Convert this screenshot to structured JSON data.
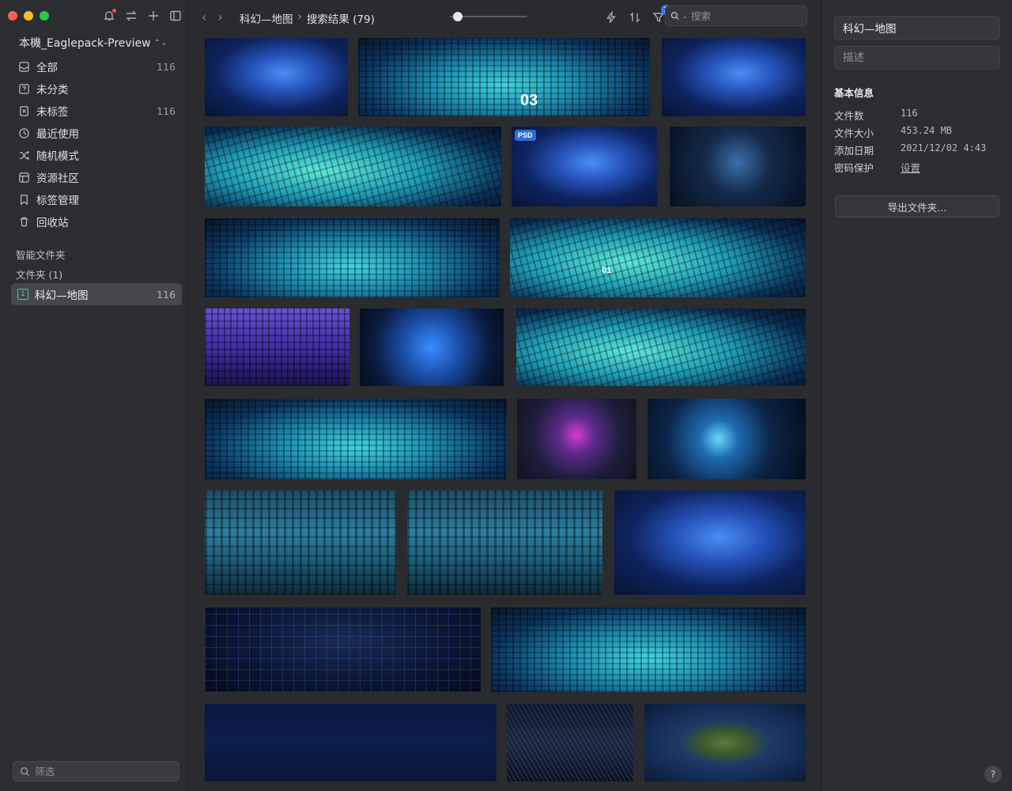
{
  "sidebar": {
    "library_name": "本機_Eaglepack-Preview",
    "items": [
      {
        "label": "全部",
        "count": "116",
        "icon": "inbox-icon"
      },
      {
        "label": "未分类",
        "count": "",
        "icon": "question-box-icon"
      },
      {
        "label": "未标签",
        "count": "116",
        "icon": "untagged-icon"
      },
      {
        "label": "最近使用",
        "count": "",
        "icon": "clock-icon"
      },
      {
        "label": "随机模式",
        "count": "",
        "icon": "shuffle-icon"
      },
      {
        "label": "资源社区",
        "count": "",
        "icon": "community-icon"
      },
      {
        "label": "标签管理",
        "count": "",
        "icon": "bookmark-icon"
      },
      {
        "label": "回收站",
        "count": "",
        "icon": "trash-icon"
      }
    ],
    "smart_folders_label": "智能文件夹",
    "folders_label": "文件夹 (1)",
    "folder": {
      "label": "科幻—地图",
      "count": "116",
      "badge": "1"
    },
    "filter_placeholder": "筛选"
  },
  "toolbar": {
    "back": "‹",
    "forward": "›",
    "breadcrumb_folder": "科幻—地图",
    "breadcrumb_sep": "›",
    "breadcrumb_current": "搜索结果 (79)",
    "zoom_level": 0.05,
    "filter_badge": "1",
    "search_placeholder": "搜索"
  },
  "thumbnails": [
    {
      "style": "map-cn",
      "label": ""
    },
    {
      "style": "city",
      "label": "03"
    },
    {
      "style": "map-cn",
      "label": ""
    },
    {
      "style": "city2",
      "label": ""
    },
    {
      "style": "map-cn",
      "label": "",
      "psd": "PSD"
    },
    {
      "style": "dark-net",
      "label": ""
    },
    {
      "style": "city",
      "label": ""
    },
    {
      "style": "city2",
      "label": "01"
    },
    {
      "style": "purple",
      "label": ""
    },
    {
      "style": "bluedot",
      "label": ""
    },
    {
      "style": "city2",
      "label": ""
    },
    {
      "style": "city",
      "label": ""
    },
    {
      "style": "pinknet",
      "label": ""
    },
    {
      "style": "hud",
      "label": ""
    },
    {
      "style": "tealcity",
      "label": ""
    },
    {
      "style": "tealcity",
      "label": ""
    },
    {
      "style": "map-cn",
      "label": ""
    },
    {
      "style": "worldgrid",
      "label": ""
    },
    {
      "style": "city",
      "label": ""
    },
    {
      "style": "dash",
      "label": ""
    },
    {
      "style": "nightcity",
      "label": ""
    },
    {
      "style": "earth",
      "label": ""
    }
  ],
  "inspector": {
    "name": "科幻—地图",
    "desc_placeholder": "描述",
    "section_title": "基本信息",
    "rows": [
      {
        "key": "文件数",
        "value": "116"
      },
      {
        "key": "文件大小",
        "value": "453.24 MB"
      },
      {
        "key": "添加日期",
        "value": "2021/12/02 4:43"
      },
      {
        "key": "密码保护",
        "value": "设置"
      }
    ],
    "export_label": "导出文件夹...",
    "help_label": "?"
  },
  "colors": {
    "accent": "#2a7cf0",
    "folder_green": "#3fd08b",
    "notif": "#ff4b4b"
  }
}
